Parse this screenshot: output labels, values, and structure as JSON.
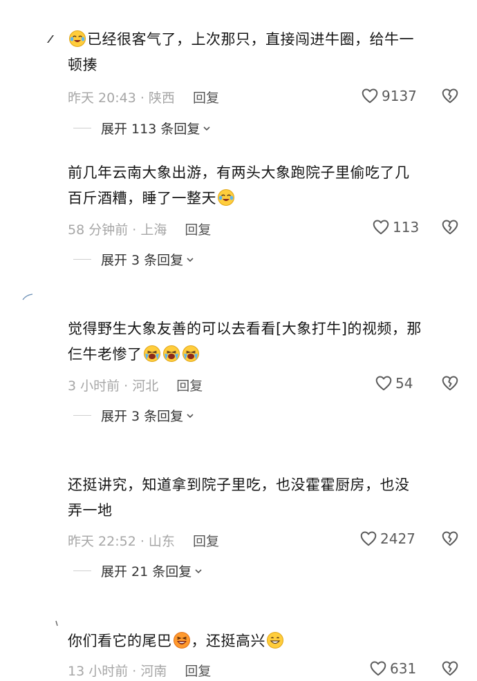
{
  "comments": [
    {
      "text_a": "已经很客气了，上次那只，直接闯进牛圈，给牛一",
      "text_b": "顿揍",
      "time": "昨天 20:43",
      "location": "陕西",
      "reply": "回复",
      "likes": "9137",
      "expand": "展开 113 条回复"
    },
    {
      "text_a": "前几年云南大象出游，有两头大象跑院子里偷吃了几",
      "text_b": "百斤酒糟，睡了一整天",
      "time": "58 分钟前",
      "location": "上海",
      "reply": "回复",
      "likes": "113",
      "expand": "展开 3 条回复"
    },
    {
      "text_a": "觉得野生大象友善的可以去看看[大象打牛]的视频，那",
      "text_b": "仨牛老惨了",
      "time": "3 小时前",
      "location": "河北",
      "reply": "回复",
      "likes": "54",
      "expand": "展开 3 条回复"
    },
    {
      "text_a": "还挺讲究，知道拿到院子里吃，也没霍霍厨房，也没",
      "text_b": "弄一地",
      "time": "昨天 22:52",
      "location": "山东",
      "reply": "回复",
      "likes": "2427",
      "expand": "展开 21 条回复"
    },
    {
      "text_a": "你们看它的尾巴",
      "text_b": "，还挺高兴",
      "time": "13 小时前",
      "location": "河南",
      "reply": "回复",
      "likes": "631"
    }
  ],
  "icons": {
    "like": "heart-outline-icon",
    "dislike": "broken-heart-icon",
    "expand": "chevron-down-icon",
    "emoji_cry": "tears-of-joy-emoji",
    "emoji_wail": "loudly-crying-emoji",
    "emoji_laugh": "laughing-emoji",
    "emoji_smile": "grinning-emoji"
  }
}
